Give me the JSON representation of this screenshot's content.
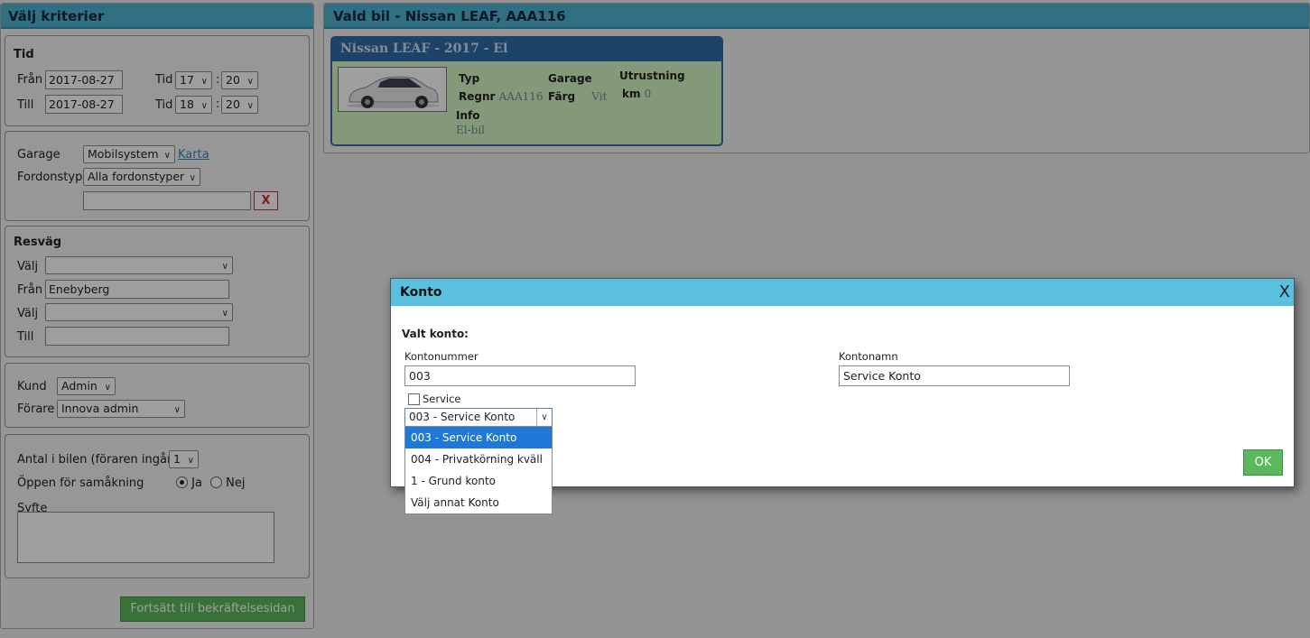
{
  "left": {
    "header": "Välj kriterier",
    "tid": {
      "title": "Tid",
      "from_label": "Från",
      "from_date": "2017-08-27",
      "to_label": "Till",
      "to_date": "2017-08-27",
      "tid_label": "Tid",
      "from_hour": "17",
      "from_min": "20",
      "to_hour": "18",
      "to_min": "20",
      "colon": ":"
    },
    "garage": {
      "garage_label": "Garage",
      "garage_value": "Mobilsystem",
      "map_link": "Karta",
      "type_label": "Fordonstyp",
      "type_value": "Alla fordonstyper",
      "search_value": "",
      "clear_label": "X"
    },
    "route": {
      "title": "Resväg",
      "select1_label": "Välj",
      "select1_value": "",
      "from_label": "Från",
      "from_value": "Enebyberg",
      "select2_label": "Välj",
      "select2_value": "",
      "to_label": "Till",
      "to_value": ""
    },
    "customer": {
      "kund_label": "Kund",
      "kund_value": "Admin",
      "driver_label": "Förare",
      "driver_value": "Innova admin"
    },
    "trip": {
      "count_label": "Antal i bilen (föraren ingår)",
      "count_value": "1",
      "share_label": "Öppen för samåkning",
      "yes_label": "Ja",
      "no_label": "Nej",
      "purpose_label": "Syfte",
      "purpose_value": ""
    },
    "continue_button": "Fortsätt till bekräftelsesidan"
  },
  "right": {
    "header": "Vald bil - Nissan LEAF, AAA116",
    "card": {
      "title": "Nissan LEAF -  2017 -  El",
      "typ_label": "Typ",
      "typ_value": "",
      "regnr_label": "Regnr",
      "regnr_value": "AAA116",
      "info_label": "Info",
      "info_value": "El-bil",
      "garage_label": "Garage",
      "garage_value": "",
      "color_label": "Färg",
      "color_value": "Vit",
      "equip_label": "Utrustning",
      "km_label": "km",
      "km_value": "0"
    }
  },
  "modal": {
    "title": "Konto",
    "close": "X",
    "selected_heading": "Valt konto:",
    "number_label": "Kontonummer",
    "number_value": "003",
    "name_label": "Kontonamn",
    "name_value": "Service Konto",
    "service_label": "Service",
    "dropdown_value": "003 - Service Konto",
    "options": [
      "003 - Service Konto",
      "004 - Privatkörning kväll",
      "1 - Grund konto",
      "Välj annat Konto"
    ],
    "ok_label": "OK"
  },
  "colors": {
    "header_blue": "#4fb3d4",
    "modal_header": "#5bc0de",
    "card_blue": "#2f6fa8",
    "card_bg": "#d6f5c6",
    "button_green": "#5cb85c",
    "selection_blue": "#1e78d7"
  }
}
